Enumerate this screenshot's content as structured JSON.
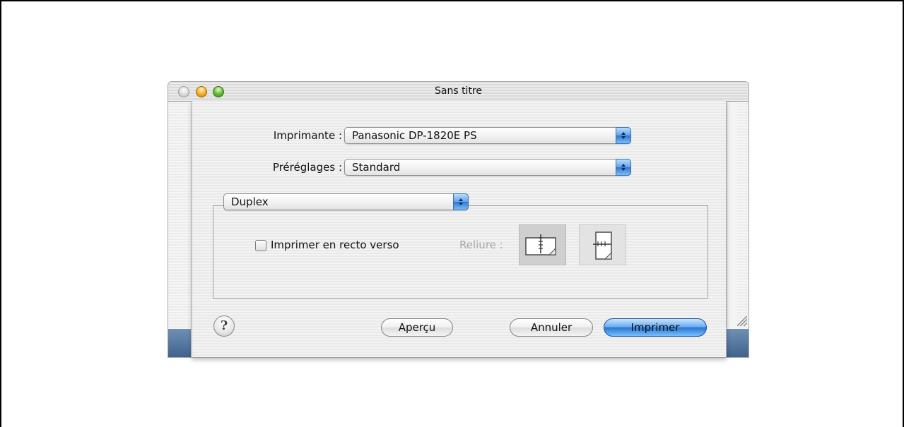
{
  "window": {
    "title": "Sans titre"
  },
  "print_dialog": {
    "printer_label": "Imprimante :",
    "printer_value": "Panasonic DP-1820E PS",
    "presets_label": "Préréglages :",
    "presets_value": "Standard",
    "panel_value": "Duplex",
    "duplex_checkbox_label": "Imprimer en recto verso",
    "duplex_checked": false,
    "binding_label": "Reliure :",
    "binding_options": [
      "long-edge-binding-icon",
      "short-edge-binding-icon"
    ],
    "buttons": {
      "help": "?",
      "preview": "Aperçu",
      "cancel": "Annuler",
      "print": "Imprimer"
    }
  },
  "colors": {
    "default_button": "#2a76d0",
    "popup_arrow": "#5ea2e8",
    "window_blue": "#40628e"
  }
}
